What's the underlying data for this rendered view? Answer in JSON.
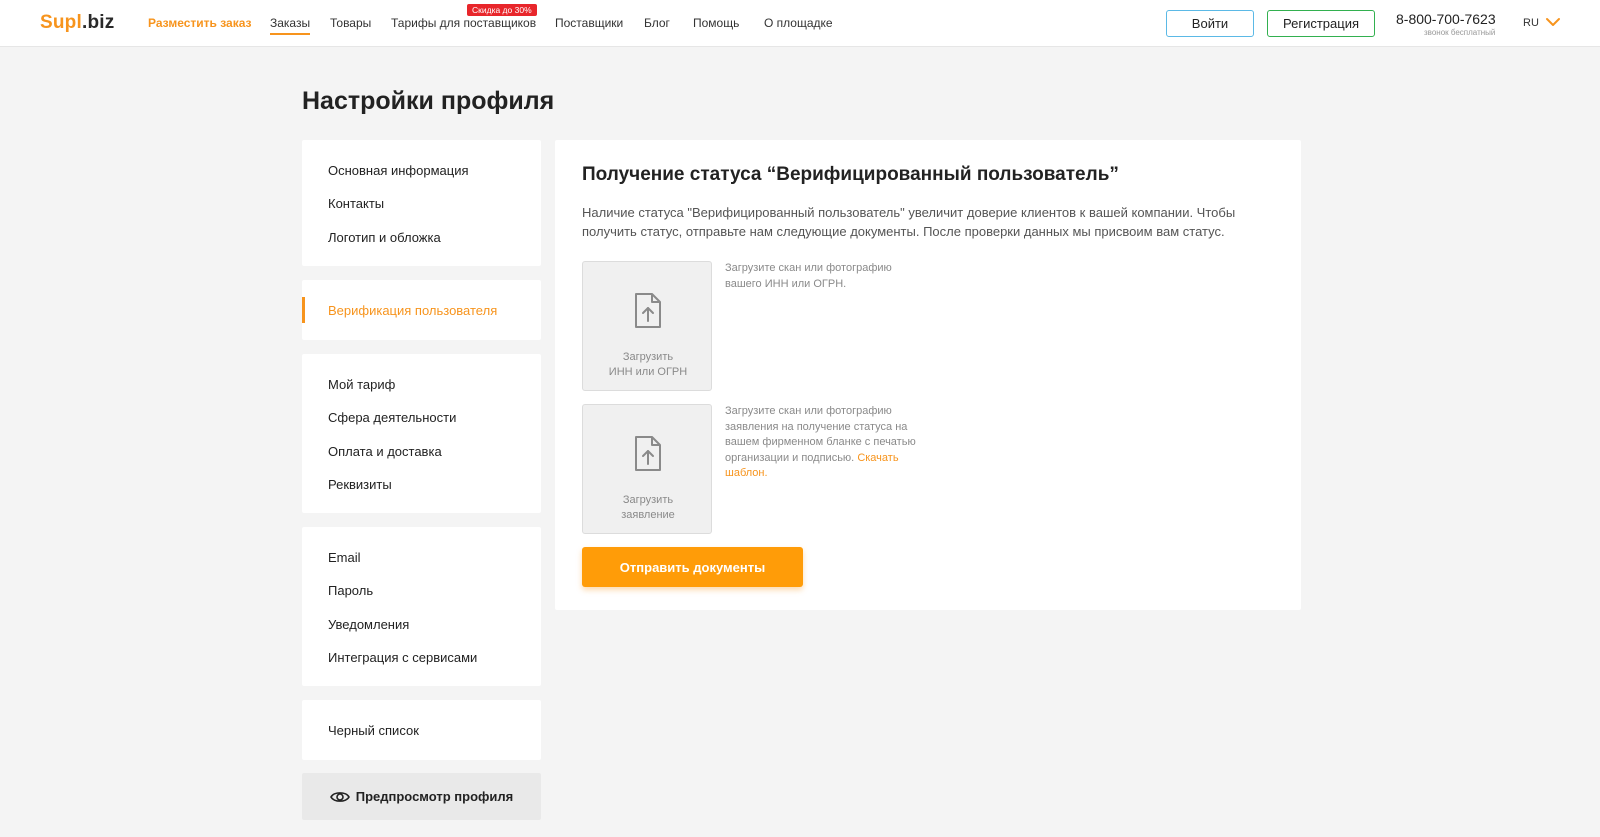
{
  "brand": {
    "name_part1": "Supl",
    "name_part2": ".biz",
    "accent": "#f7941d"
  },
  "nav": {
    "place_order": "Разместить заказ",
    "orders": "Заказы",
    "goods": "Товары",
    "tariffs": "Тарифы для поставщиков",
    "tariffs_badge": "Скидка до 30%",
    "suppliers": "Поставщики",
    "blog": "Блог",
    "help": "Помощь",
    "about": "О площадке"
  },
  "auth": {
    "login": "Войти",
    "register": "Регистрация"
  },
  "contact": {
    "phone": "8-800-700-7623",
    "phone_note": "звонок бесплатный",
    "lang": "RU"
  },
  "page": {
    "title": "Настройки профиля"
  },
  "sidebar": {
    "group1": [
      "Основная информация",
      "Контакты",
      "Логотип и обложка"
    ],
    "group2": [
      "Верификация пользователя"
    ],
    "group3": [
      "Мой тариф",
      "Сфера деятельности",
      "Оплата и доставка",
      "Реквизиты"
    ],
    "group4": [
      "Email",
      "Пароль",
      "Уведомления",
      "Интеграция с сервисами"
    ],
    "group5": [
      "Черный список"
    ],
    "preview": "Предпросмотр профиля"
  },
  "main": {
    "title": "Получение статуса “Верифицированный пользователь”",
    "description": "Наличие статуса \"Верифицированный пользователь\" увеличит доверие клиентов к вашей компании. Чтобы получить статус, отправьте нам следующие документы. После проверки данных мы присвоим вам статус.",
    "upload1": {
      "label": "Загрузить\nИНН или ОГРН",
      "hint": "Загрузите скан или фотографию вашего ИНН или ОГРН."
    },
    "upload2": {
      "label": "Загрузить\nзаявление",
      "hint": "Загрузите скан или фотографию заявления на получение статуса на вашем фирменном бланке с печатью организации и подписью.",
      "link": "Скачать шаблон."
    },
    "submit": "Отправить документы"
  }
}
